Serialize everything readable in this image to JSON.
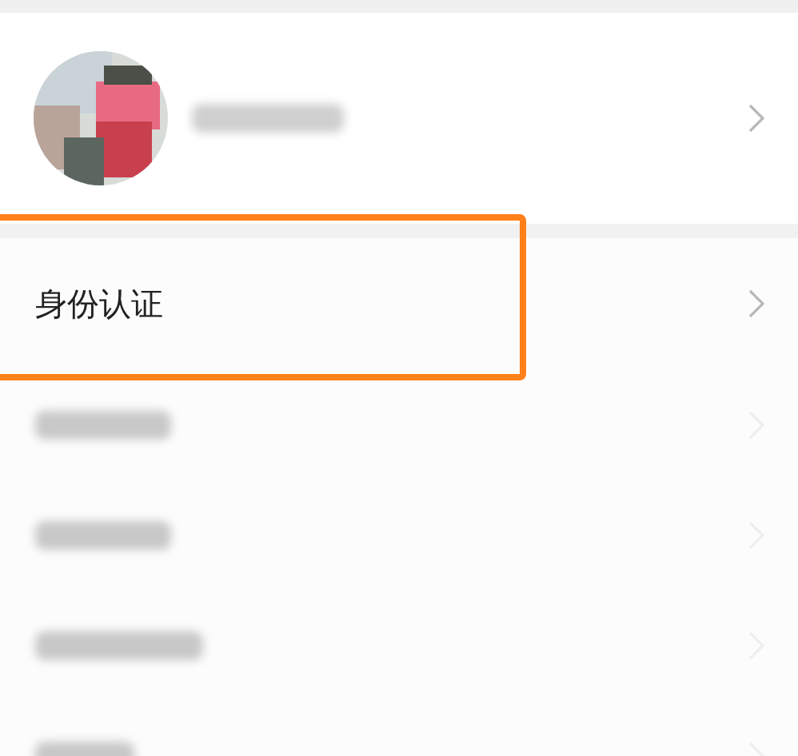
{
  "profile": {
    "kind": "blurred"
  },
  "items": [
    {
      "kind": "text",
      "label": "身份认证",
      "highlighted": true
    },
    {
      "kind": "blurred",
      "highlighted": false
    },
    {
      "kind": "blurred",
      "highlighted": false
    },
    {
      "kind": "blurred",
      "highlighted": false
    },
    {
      "kind": "blurred",
      "highlighted": false
    }
  ]
}
